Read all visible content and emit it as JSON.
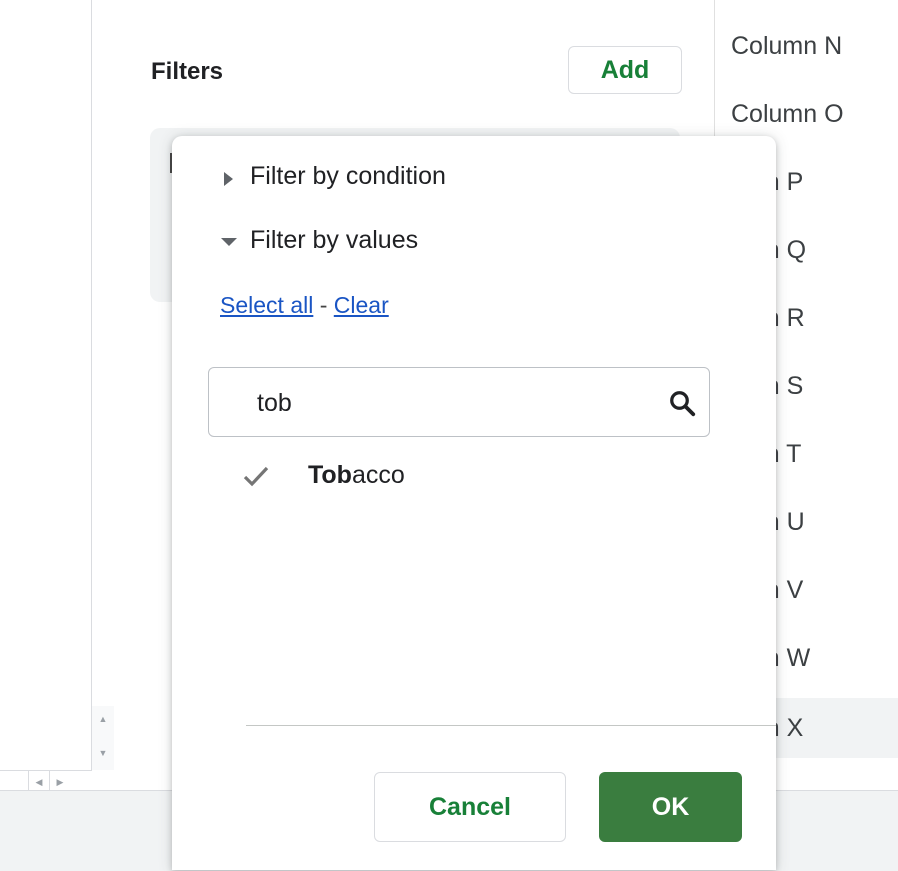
{
  "panel": {
    "title": "Filters",
    "add_label": "Add"
  },
  "columns": [
    "Column N",
    "Column O",
    "umn P",
    "umn Q",
    "umn R",
    "umn S",
    "umn T",
    "umn U",
    "umn V",
    "umn W",
    "umn X"
  ],
  "dropdown": {
    "filter_by_condition": "Filter by condition",
    "filter_by_values": "Filter by values",
    "select_all": "Select all",
    "separator": "-",
    "clear": "Clear",
    "search": {
      "value": "tob",
      "icon": "search-icon"
    },
    "values": [
      {
        "match": "Tob",
        "rest": "acco",
        "checked": true
      }
    ],
    "cancel_label": "Cancel",
    "ok_label": "OK"
  },
  "colors": {
    "accent_green": "#188038",
    "ok_background": "#3a7d3f",
    "link_blue": "#1a55c4"
  }
}
